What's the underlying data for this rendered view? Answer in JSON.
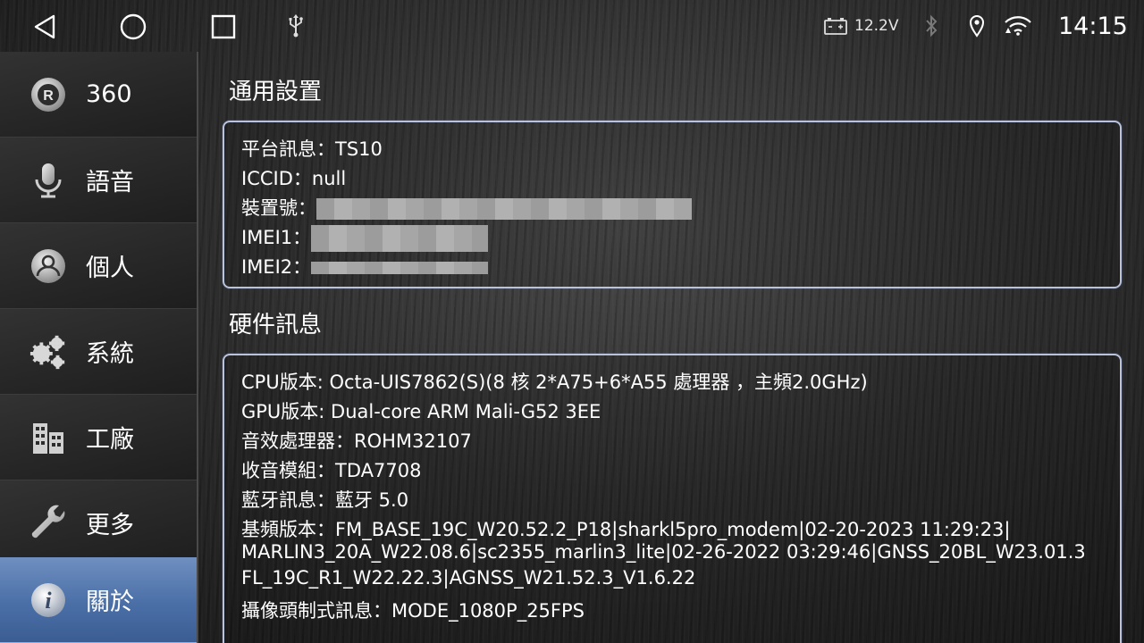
{
  "status_bar": {
    "voltage": "12.2V",
    "time": "14:15",
    "icons": [
      "back-icon",
      "home-icon",
      "recent-apps-icon",
      "usb-icon",
      "battery-icon",
      "bluetooth-icon",
      "location-icon",
      "wifi-icon"
    ]
  },
  "sidebar": {
    "items": [
      {
        "label": "360",
        "icon": "r-badge-icon",
        "active": false
      },
      {
        "label": "語音",
        "icon": "microphone-icon",
        "active": false
      },
      {
        "label": "個人",
        "icon": "user-icon",
        "active": false
      },
      {
        "label": "系統",
        "icon": "gears-icon",
        "active": false
      },
      {
        "label": "工廠",
        "icon": "factory-icon",
        "active": false
      },
      {
        "label": "更多",
        "icon": "wrench-icon",
        "active": false
      },
      {
        "label": "關於",
        "icon": "info-icon",
        "active": true
      }
    ],
    "active_color": "#4a6fa7"
  },
  "general": {
    "title": "通用設置",
    "platform_label": "平台訊息：",
    "platform_value": "TS10",
    "iccid_label": "ICCID：",
    "iccid_value": "null",
    "device_label": "裝置號：",
    "imei1_label": "IMEI1：",
    "imei2_label": "IMEI2："
  },
  "hardware": {
    "title": "硬件訊息",
    "cpu": "CPU版本: Octa-UIS7862(S)(8 核 2*A75+6*A55 處理器 ，主頻2.0GHz)",
    "gpu": "GPU版本: Dual-core ARM Mali-G52 3EE",
    "audio_label": "音效處理器：",
    "audio_value": "ROHM32107",
    "radio_label": "收音模組：",
    "radio_value": "TDA7708",
    "bt_label": "藍牙訊息：",
    "bt_value": "藍牙 5.0",
    "baseband_label": "基頻版本：",
    "baseband_line1": "FM_BASE_19C_W20.52.2_P18|sharkl5pro_modem|02-20-2023 11:29:23|",
    "baseband_line2": "MARLIN3_20A_W22.08.6|sc2355_marlin3_lite|02-26-2022 03:29:46|GNSS_20BL_W23.01.3",
    "baseband_line3": "FL_19C_R1_W22.22.3|AGNSS_W21.52.3_V1.6.22",
    "camera_label": "攝像頭制式訊息：",
    "camera_value": "MODE_1080P_25FPS"
  }
}
